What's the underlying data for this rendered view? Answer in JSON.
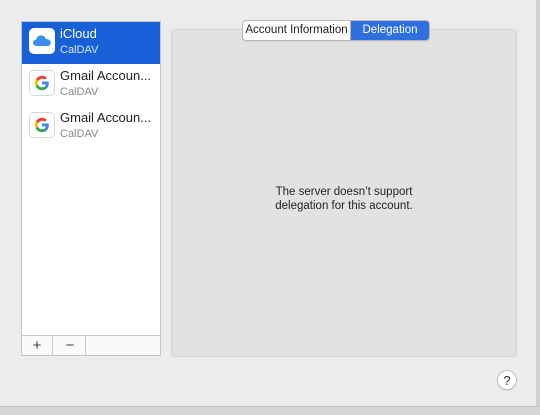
{
  "accounts": [
    {
      "name": "iCloud",
      "type": "CalDAV",
      "icon": "icloud-icon",
      "selected": true
    },
    {
      "name": "Gmail Accoun...",
      "type": "CalDAV",
      "icon": "google-icon",
      "selected": false
    },
    {
      "name": "Gmail Accoun...",
      "type": "CalDAV",
      "icon": "google-icon",
      "selected": false
    }
  ],
  "sidebar_toolbar": {
    "add_label": "+",
    "remove_label": "−"
  },
  "tabs": [
    {
      "label": "Account Information",
      "active": false
    },
    {
      "label": "Delegation",
      "active": true
    }
  ],
  "message": {
    "line1": "The server doesn’t support",
    "line2": "delegation for this account."
  },
  "help_label": "?",
  "colors": {
    "selection": "#1860d8",
    "active_tab": "#2f6fe0",
    "icloud_blue": "#3a8ef0"
  }
}
